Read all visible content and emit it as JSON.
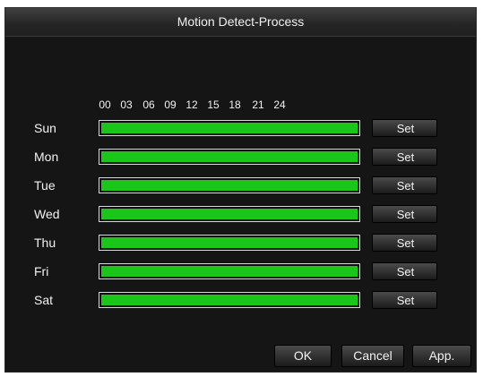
{
  "title": "Motion Detect-Process",
  "hours": [
    "00",
    "03",
    "06",
    "09",
    "12",
    "15",
    "18",
    "21",
    "24"
  ],
  "days": [
    {
      "label": "Sun",
      "set_label": "Set",
      "coverage": 1.0
    },
    {
      "label": "Mon",
      "set_label": "Set",
      "coverage": 1.0
    },
    {
      "label": "Tue",
      "set_label": "Set",
      "coverage": 1.0
    },
    {
      "label": "Wed",
      "set_label": "Set",
      "coverage": 1.0
    },
    {
      "label": "Thu",
      "set_label": "Set",
      "coverage": 1.0
    },
    {
      "label": "Fri",
      "set_label": "Set",
      "coverage": 1.0
    },
    {
      "label": "Sat",
      "set_label": "Set",
      "coverage": 1.0
    }
  ],
  "buttons": {
    "ok": "OK",
    "cancel": "Cancel",
    "apply": "App."
  },
  "colors": {
    "schedule_fill": "#19c619",
    "background": "#151515"
  }
}
